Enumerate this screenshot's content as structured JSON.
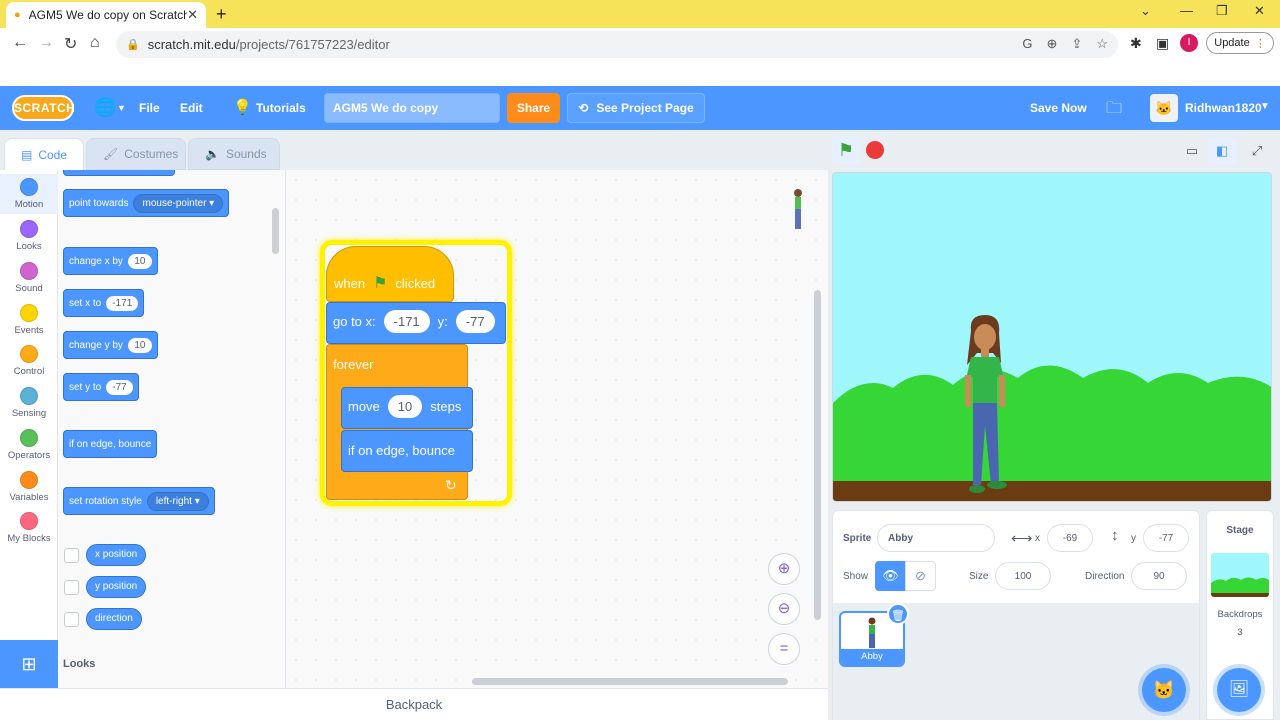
{
  "browser": {
    "tab_title": "AGM5 We do copy on Scratch",
    "url_host": "scratch.mit.edu",
    "url_path": "/projects/761757223/editor",
    "update_label": "Update",
    "profile_initial": "I"
  },
  "menubar": {
    "logo": "SCRATCH",
    "file": "File",
    "edit": "Edit",
    "tutorials": "Tutorials",
    "project_title": "AGM5 We do copy",
    "share": "Share",
    "see_project_page": "See Project Page",
    "save_now": "Save Now",
    "username": "Ridhwan1820"
  },
  "tabs": {
    "code": "Code",
    "costumes": "Costumes",
    "sounds": "Sounds"
  },
  "categories": [
    {
      "label": "Motion",
      "color": "#4c97ff"
    },
    {
      "label": "Looks",
      "color": "#9966ff"
    },
    {
      "label": "Sound",
      "color": "#cf63cf"
    },
    {
      "label": "Events",
      "color": "#ffd500"
    },
    {
      "label": "Control",
      "color": "#ffab19"
    },
    {
      "label": "Sensing",
      "color": "#5cb1d6"
    },
    {
      "label": "Operators",
      "color": "#59c059"
    },
    {
      "label": "Variables",
      "color": "#ff8c1a"
    },
    {
      "label": "My Blocks",
      "color": "#ff6680"
    }
  ],
  "palette": {
    "point_towards": "point towards",
    "point_target": "mouse-pointer",
    "change_x": "change x by",
    "change_x_val": "10",
    "set_x": "set x to",
    "set_x_val": "-171",
    "change_y": "change y by",
    "change_y_val": "10",
    "set_y": "set y to",
    "set_y_val": "-77",
    "edge_bounce": "if on edge, bounce",
    "rotation_style": "set rotation style",
    "rotation_val": "left-right",
    "x_position": "x position",
    "y_position": "y position",
    "direction": "direction",
    "looks_heading": "Looks"
  },
  "script": {
    "when": "when",
    "clicked": "clicked",
    "goto": "go to x:",
    "goto_x": "-171",
    "y": "y:",
    "goto_y": "-77",
    "forever": "forever",
    "move": "move",
    "move_val": "10",
    "steps": "steps",
    "bounce": "if on edge, bounce"
  },
  "backpack": "Backpack",
  "sprite_info": {
    "sprite_label": "Sprite",
    "sprite_name": "Abby",
    "x_label": "x",
    "x_val": "-69",
    "y_label": "y",
    "y_val": "-77",
    "show_label": "Show",
    "size_label": "Size",
    "size_val": "100",
    "direction_label": "Direction",
    "direction_val": "90",
    "thumb_name": "Abby"
  },
  "stage_pane": {
    "heading": "Stage",
    "backdrops_label": "Backdrops",
    "backdrops_count": "3"
  },
  "colors": {
    "scratch_blue": "#4c97ff",
    "events_yellow": "#ffbf00",
    "control_orange": "#ffab19",
    "share_orange": "#ff8c1a",
    "sky": "#9ff6fb",
    "grass": "#35d635",
    "ground": "#6b3c12"
  }
}
